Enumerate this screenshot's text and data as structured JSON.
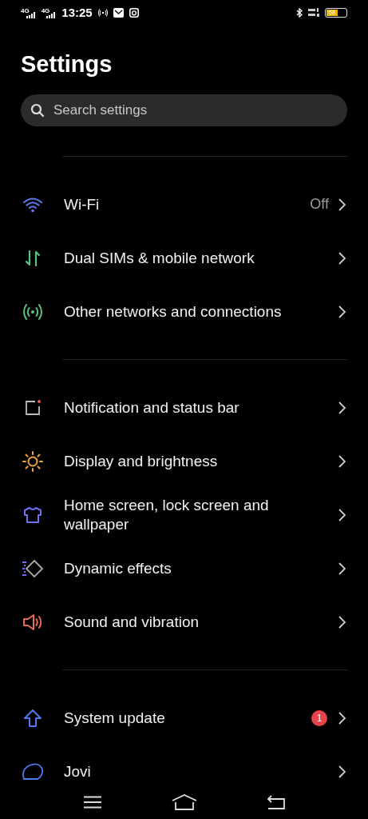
{
  "status_bar": {
    "sim_1": "4G",
    "sim_2": "4G",
    "time": "13:25",
    "battery": "58"
  },
  "title": "Settings",
  "search": {
    "placeholder": "Search settings"
  },
  "sections": [
    {
      "items": [
        {
          "kind": "wifi",
          "label": "Wi-Fi",
          "value": "Off"
        },
        {
          "kind": "sim",
          "label": "Dual SIMs & mobile network"
        },
        {
          "kind": "network",
          "label": "Other networks and connections"
        }
      ]
    },
    {
      "items": [
        {
          "kind": "notification",
          "label": "Notification and status bar"
        },
        {
          "kind": "display",
          "label": "Display and brightness"
        },
        {
          "kind": "theme",
          "label": "Home screen, lock screen and wallpaper"
        },
        {
          "kind": "effects",
          "label": "Dynamic effects"
        },
        {
          "kind": "sound",
          "label": "Sound and vibration"
        }
      ]
    },
    {
      "items": [
        {
          "kind": "update",
          "label": "System update",
          "badge": "1"
        },
        {
          "kind": "assistant",
          "label": "Jovi"
        }
      ]
    }
  ]
}
